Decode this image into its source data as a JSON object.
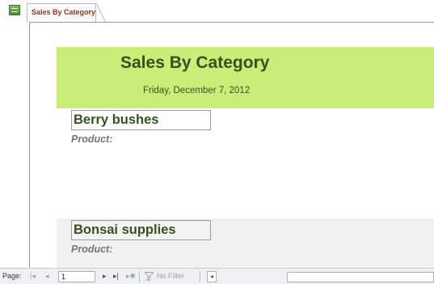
{
  "tab": {
    "icon": "report-icon",
    "label": "Sales By Category"
  },
  "report": {
    "title": "Sales By Category",
    "date": "Friday, December 7, 2012",
    "header_color": "#c8ee79",
    "text_color": "#35511c"
  },
  "groups": [
    {
      "name": "Berry bushes",
      "field_label": "Product:"
    },
    {
      "name": "Bonsai supplies",
      "field_label": "Product:"
    }
  ],
  "navbar": {
    "page_label": "Page:",
    "first_icon": "first-record-icon",
    "prev_icon": "previous-record-icon",
    "current_page": "1",
    "next_icon": "next-record-icon",
    "last_icon": "last-record-icon",
    "new_icon": "new-record-icon",
    "filter_icon": "no-filter-icon",
    "filter_label": "No Filter",
    "scroll_left_icon": "scroll-left-icon"
  }
}
